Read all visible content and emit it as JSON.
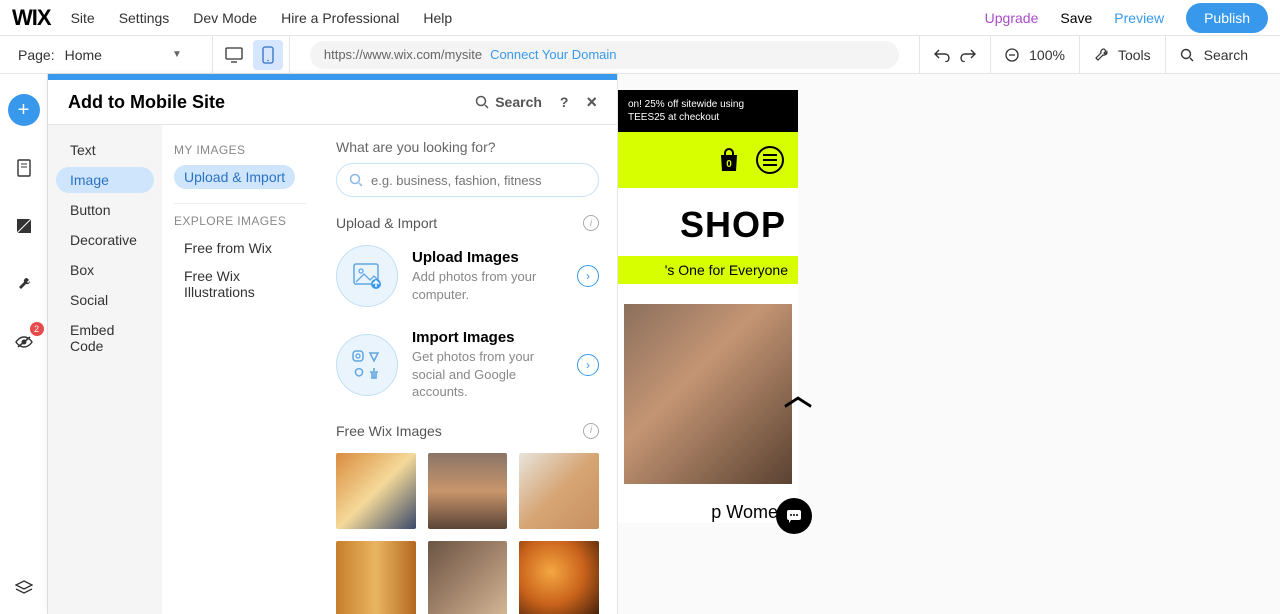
{
  "topbar": {
    "logo": "WIX",
    "menu": [
      "Site",
      "Settings",
      "Dev Mode",
      "Hire a Professional",
      "Help"
    ],
    "upgrade": "Upgrade",
    "save": "Save",
    "preview": "Preview",
    "publish": "Publish"
  },
  "secondbar": {
    "page_label": "Page:",
    "page_name": "Home",
    "url": "https://www.wix.com/mysite",
    "connect": "Connect Your Domain",
    "zoom": "100%",
    "tools": "Tools",
    "search": "Search"
  },
  "leftrail": {
    "badge": "2"
  },
  "panel": {
    "title": "Add to Mobile Site",
    "search_label": "Search",
    "categories": [
      "Text",
      "Image",
      "Button",
      "Decorative",
      "Box",
      "Social",
      "Embed Code"
    ],
    "active_category": "Image",
    "sub_my_images_head": "MY IMAGES",
    "sub_upload_import": "Upload & Import",
    "sub_explore_head": "EXPLORE IMAGES",
    "sub_free_wix": "Free from Wix",
    "sub_illustrations": "Free Wix Illustrations",
    "content": {
      "prompt": "What are you looking for?",
      "placeholder": "e.g. business, fashion, fitness",
      "upload_section": "Upload & Import",
      "upload_title": "Upload Images",
      "upload_desc": "Add photos from your computer.",
      "import_title": "Import Images",
      "import_desc": "Get photos from your social and Google accounts.",
      "free_wix_section": "Free Wix Images"
    }
  },
  "canvas": {
    "banner_line1": "on! 25% off sitewide using",
    "banner_line2": "TEES25 at checkout",
    "bag_count": "0",
    "title": "SHOP",
    "strip": "'s One for Everyone",
    "shop_women": "p Women"
  }
}
